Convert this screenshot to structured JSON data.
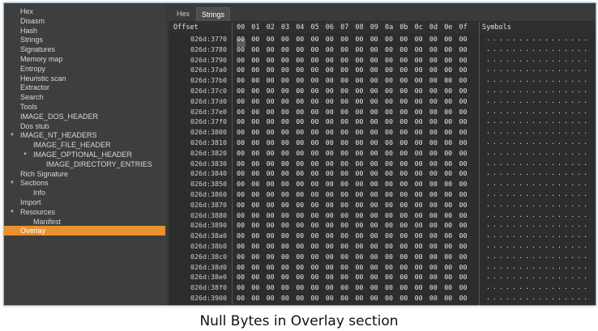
{
  "sidebar": {
    "items": [
      {
        "label": "Hex",
        "level": 1,
        "arrow": "",
        "selected": false
      },
      {
        "label": "Disasm",
        "level": 1,
        "arrow": "",
        "selected": false
      },
      {
        "label": "Hash",
        "level": 1,
        "arrow": "",
        "selected": false
      },
      {
        "label": "Strings",
        "level": 1,
        "arrow": "",
        "selected": false
      },
      {
        "label": "Signatures",
        "level": 1,
        "arrow": "",
        "selected": false
      },
      {
        "label": "Memory map",
        "level": 1,
        "arrow": "",
        "selected": false
      },
      {
        "label": "Entropy",
        "level": 1,
        "arrow": "",
        "selected": false
      },
      {
        "label": "Heuristic scan",
        "level": 1,
        "arrow": "",
        "selected": false
      },
      {
        "label": "Extractor",
        "level": 1,
        "arrow": "",
        "selected": false
      },
      {
        "label": "Search",
        "level": 1,
        "arrow": "",
        "selected": false
      },
      {
        "label": "Tools",
        "level": 1,
        "arrow": "",
        "selected": false
      },
      {
        "label": "IMAGE_DOS_HEADER",
        "level": 1,
        "arrow": "",
        "selected": false
      },
      {
        "label": "Dos stub",
        "level": 1,
        "arrow": "",
        "selected": false
      },
      {
        "label": "IMAGE_NT_HEADERS",
        "level": 1,
        "arrow": "▼",
        "selected": false
      },
      {
        "label": "IMAGE_FILE_HEADER",
        "level": 2,
        "arrow": "",
        "selected": false
      },
      {
        "label": "IMAGE_OPTIONAL_HEADER",
        "level": 2,
        "arrow": "▼",
        "selected": false
      },
      {
        "label": "IMAGE_DIRECTORY_ENTRIES",
        "level": 3,
        "arrow": "",
        "selected": false
      },
      {
        "label": "Rich Signature",
        "level": 1,
        "arrow": "",
        "selected": false
      },
      {
        "label": "Sections",
        "level": 1,
        "arrow": "▼",
        "selected": false
      },
      {
        "label": "Info",
        "level": 2,
        "arrow": "",
        "selected": false
      },
      {
        "label": "Import",
        "level": 1,
        "arrow": "",
        "selected": false
      },
      {
        "label": "Resources",
        "level": 1,
        "arrow": "▼",
        "selected": false
      },
      {
        "label": "Manifest",
        "level": 2,
        "arrow": "",
        "selected": false
      },
      {
        "label": "Overlay",
        "level": 1,
        "arrow": "",
        "selected": true
      }
    ]
  },
  "tabs": [
    {
      "label": "Hex",
      "active": false
    },
    {
      "label": "Strings",
      "active": true
    }
  ],
  "hex": {
    "offset_header": "Offset",
    "byte_headers": [
      "00",
      "01",
      "02",
      "03",
      "04",
      "05",
      "06",
      "07",
      "08",
      "09",
      "0a",
      "0b",
      "0c",
      "0d",
      "0e",
      "0f"
    ],
    "symbols_header": "Symbols",
    "offsets": [
      "026d:3770",
      "026d:3780",
      "026d:3790",
      "026d:37a0",
      "026d:37b0",
      "026d:37c0",
      "026d:37d0",
      "026d:37e0",
      "026d:37f0",
      "026d:3800",
      "026d:3810",
      "026d:3820",
      "026d:3830",
      "026d:3840",
      "026d:3850",
      "026d:3860",
      "026d:3870",
      "026d:3880",
      "026d:3890",
      "026d:38a0",
      "026d:38b0",
      "026d:38c0",
      "026d:38d0",
      "026d:38e0",
      "026d:38f0",
      "026d:3900"
    ],
    "byte_value": "00",
    "symbols_row": "................"
  },
  "caption": "Null Bytes in Overlay section",
  "colors": {
    "selected": "#e8912d",
    "background": "#2d2d2d",
    "sidebar": "#3e3e3e"
  }
}
